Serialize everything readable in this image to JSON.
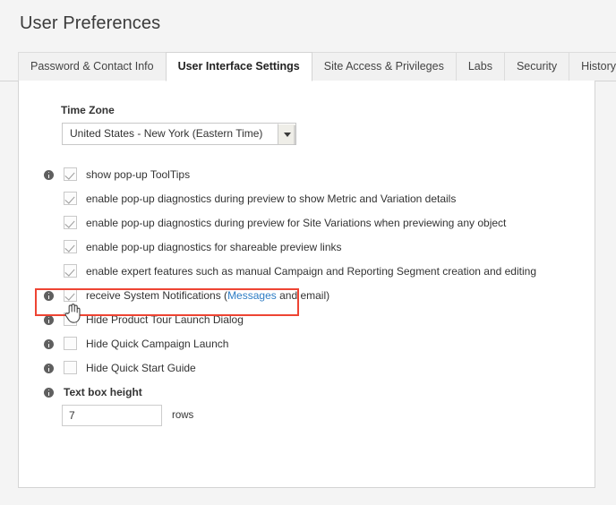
{
  "page": {
    "title": "User Preferences",
    "background_color": "#f4f4f4"
  },
  "tabs": [
    {
      "label": "Password & Contact Info",
      "active": false
    },
    {
      "label": "User Interface Settings",
      "active": true
    },
    {
      "label": "Site Access & Privileges",
      "active": false
    },
    {
      "label": "Labs",
      "active": false
    },
    {
      "label": "Security",
      "active": false
    },
    {
      "label": "History",
      "active": false
    }
  ],
  "timezone": {
    "label": "Time Zone",
    "selected": "United States - New York (Eastern Time)",
    "arrow_icon": "chevron-down-icon"
  },
  "options": [
    {
      "label": "show pop-up ToolTips",
      "checked": true,
      "info": true,
      "info_icon": "info-icon"
    },
    {
      "label": "enable pop-up diagnostics during preview to show Metric and Variation details",
      "checked": true,
      "info": false
    },
    {
      "label": "enable pop-up diagnostics during preview for Site Variations when previewing any object",
      "checked": true,
      "info": false
    },
    {
      "label": "enable pop-up diagnostics for shareable preview links",
      "checked": true,
      "info": false
    },
    {
      "label": "enable expert features such as manual Campaign and Reporting Segment creation and editing",
      "checked": true,
      "info": false
    },
    {
      "label_prefix": "receive System Notifications (",
      "link_text": "Messages",
      "label_suffix": " and email)",
      "checked": true,
      "info": true,
      "info_icon": "info-icon",
      "highlighted": true,
      "link_color": "#2e7cc4"
    },
    {
      "label": "Hide Product Tour Launch Dialog",
      "checked": false,
      "info": true,
      "info_icon": "info-icon"
    },
    {
      "label": "Hide Quick Campaign Launch",
      "checked": false,
      "info": true,
      "info_icon": "info-icon"
    },
    {
      "label": "Hide Quick Start Guide",
      "checked": false,
      "info": true,
      "info_icon": "info-icon"
    }
  ],
  "text_box_height": {
    "label": "Text box height",
    "info_icon": "info-icon",
    "value": "7",
    "placeholder": "",
    "unit": "rows"
  },
  "annotation": {
    "highlight_color": "#ee4433",
    "cursor_icon": "hand-pointer-cursor"
  }
}
